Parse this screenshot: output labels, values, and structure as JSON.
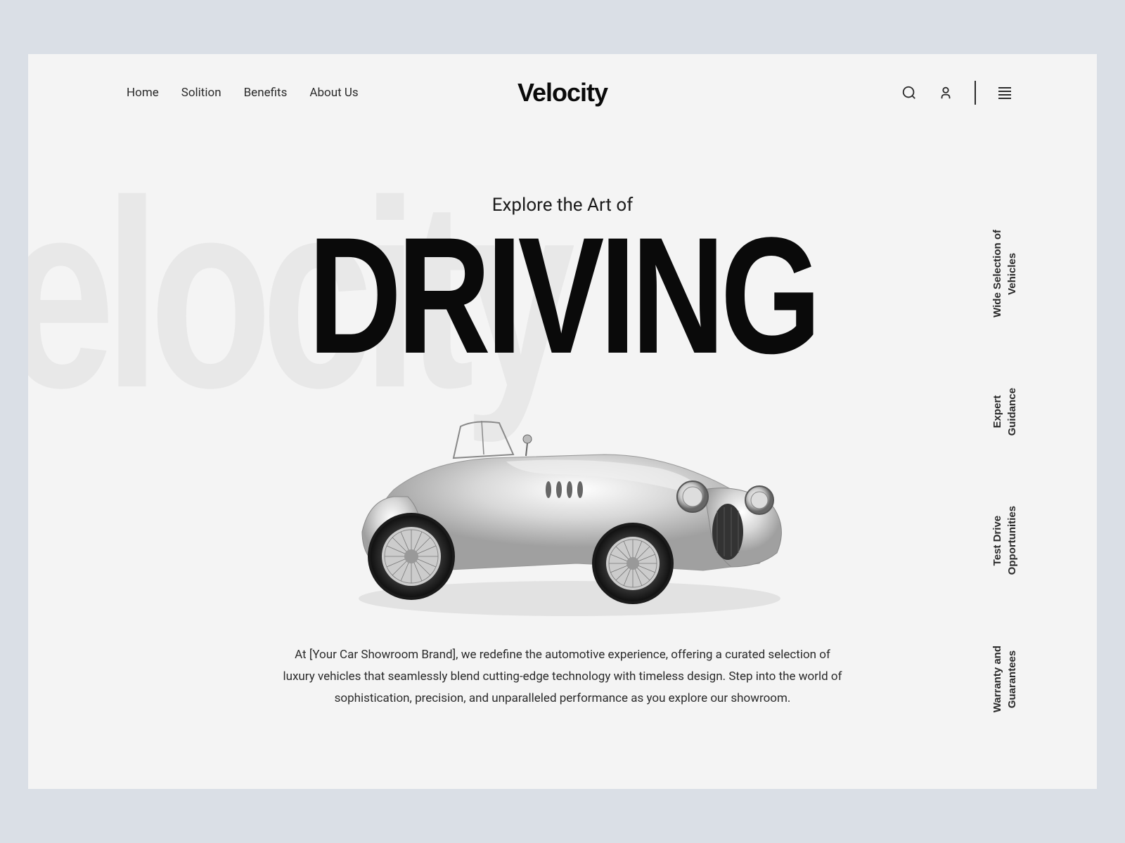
{
  "brand": "Velocity",
  "watermark": "elocity",
  "nav": {
    "items": [
      "Home",
      "Solition",
      "Benefits",
      "About Us"
    ]
  },
  "hero": {
    "subtitle": "Explore the Art of",
    "title": "DRIVING",
    "description": "At [Your Car Showroom Brand], we redefine the automotive experience, offering a curated selection of luxury vehicles that seamlessly blend cutting-edge technology with timeless design. Step into the world of sophistication, precision, and unparalleled performance as you explore our showroom."
  },
  "features": [
    "Wide Selection of\nVehicles",
    "Expert\nGuidance",
    "Test Drive\nOpportunities",
    "Warranty and\nGuarantees"
  ]
}
